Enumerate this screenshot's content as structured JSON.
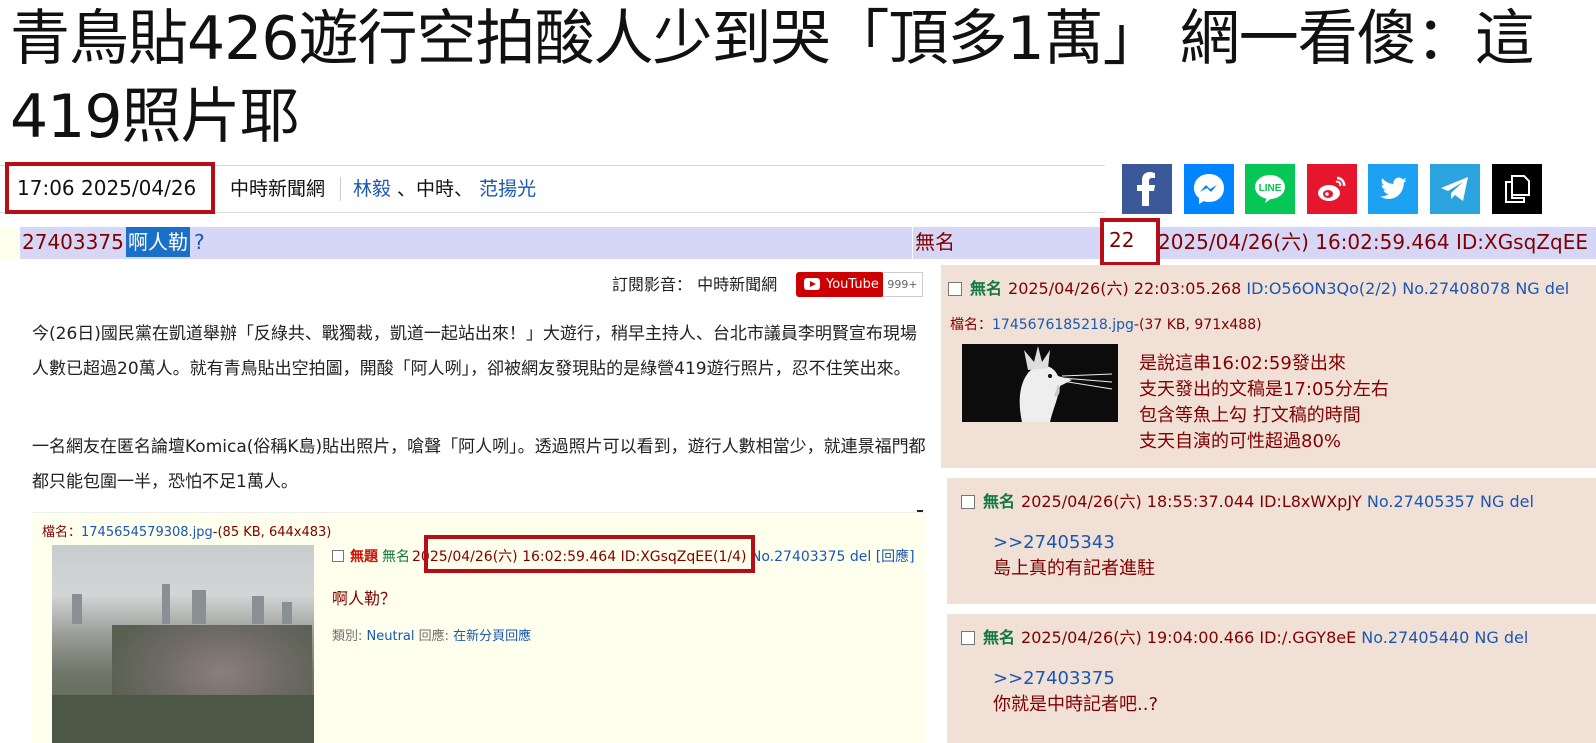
{
  "headline": "青鳥貼426遊行空拍酸人少到哭「頂多1萬」 網一看傻：這419照片耶",
  "meta": {
    "time": "17:06  2025/04/26",
    "source": "中時新聞網",
    "author1": "林毅",
    "sep1": " 、中時、 ",
    "author2": "范揚光"
  },
  "share_icons": [
    "facebook-icon",
    "messenger-icon",
    "line-icon",
    "weibo-icon",
    "twitter-icon",
    "telegram-icon",
    "copy-icon"
  ],
  "thread_bar": {
    "id": "27403375",
    "title": "啊人勒",
    "q": "?",
    "name": "無名",
    "count": "22",
    "date": "2025/04/26(六) 16:02:59.464 ID:XGsqZqEE"
  },
  "subscribe": {
    "label": "訂閱影音： 中時新聞網",
    "youtube": "YouTube",
    "count": "999+"
  },
  "paragraphs": [
    "今(26日)國民黨在凱道舉辦「反綠共、戰獨裁，凱道一起站出來！」大遊行，稍早主持人、台北市議員李明賢宣布現場人數已超過20萬人。就有青鳥貼出空拍圖，開酸「阿人咧」，卻被網友發現貼的是綠營419遊行照片，忍不住笑出來。",
    "一名網友在匿名論壇Komica(俗稱K島)貼出照片，嗆聲「阿人咧」。透過照片可以看到，遊行人數相當少，就連景福門都都只能包圍一半，恐怕不足1萬人。"
  ],
  "inner": {
    "file_label": "檔名：",
    "file_name": "1745654579308.jpg",
    "file_info": "-(85 KB, 644x483)",
    "subject": "無題",
    "name": "無名",
    "date": "2025/04/26(六) 16:02:59.464 ID:XGsqZqEE(1/4)",
    "no": "No.27403375",
    "del": "del",
    "reply": "[回應]",
    "body": "啊人勒？",
    "cat_label": "類別: ",
    "cat_value": "Neutral",
    "reply_label": " 回應: ",
    "reply_link": "在新分頁回應"
  },
  "replies": [
    {
      "name": "無名",
      "date": "2025/04/26(六) 22:03:05.268",
      "id": "ID:O56ON3Qo(2/2)",
      "no": "No.27408078",
      "ng": "NG",
      "del": "del",
      "file_label": "檔名：",
      "file_name": "1745676185218.jpg",
      "file_info": "-(37 KB, 971x488)",
      "lines": [
        "是說這串16:02:59發出來",
        "支天發出的文稿是17:05分左右",
        "包含等魚上勾 打文稿的時間",
        "支天自演的可性超過80%"
      ]
    },
    {
      "name": "無名",
      "date": "2025/04/26(六) 18:55:37.044",
      "id": "ID:L8xWXpJY",
      "no": "No.27405357",
      "ng": "NG",
      "del": "del",
      "quote": ">>27405343",
      "line": "島上真的有記者進駐"
    },
    {
      "name": "無名",
      "date": "2025/04/26(六) 19:04:00.466",
      "id": "ID:/.GGY8eE",
      "no": "No.27405440",
      "ng": "NG",
      "del": "del",
      "quote": ">>27403375",
      "line": "你就是中時記者吧..?"
    }
  ],
  "colors": {
    "highlight_box": "#b50e16",
    "link": "#1a57b5",
    "post_text": "#800000",
    "poster_name": "#117743",
    "reply_bg": "#f0e0d6",
    "thread_bar_bg": "#d6d6f7"
  }
}
